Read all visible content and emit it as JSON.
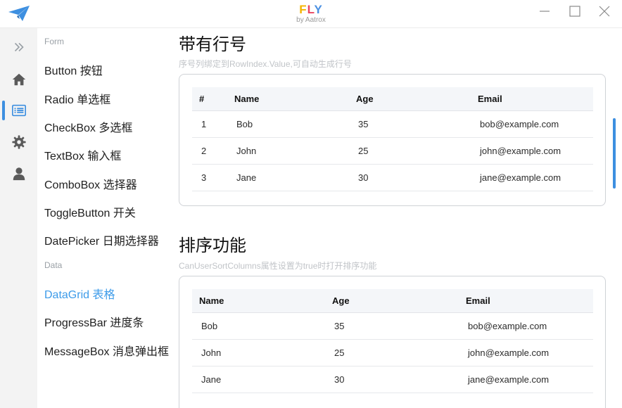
{
  "titlebar": {
    "brand_letters": [
      "F",
      "L",
      "Y"
    ],
    "brand_sub": "by Aatrox"
  },
  "rail": {
    "icons": [
      "chevron-double-right-icon",
      "home-icon",
      "list-icon",
      "gear-icon",
      "user-icon"
    ],
    "active_index": 2
  },
  "nav": {
    "groups": [
      {
        "label": "Form",
        "items": [
          "Button 按钮",
          "Radio 单选框",
          "CheckBox 多选框",
          "TextBox 输入框",
          "ComboBox 选择器",
          "ToggleButton 开关",
          "DatePicker 日期选择器"
        ]
      },
      {
        "label": "Data",
        "items": [
          "DataGrid 表格",
          "ProgressBar 进度条",
          "MessageBox 消息弹出框"
        ]
      }
    ],
    "active_item": "DataGrid 表格"
  },
  "sections": [
    {
      "title": "带有行号",
      "desc": "序号列绑定到RowIndex.Value,可自动生成行号",
      "columns": [
        "#",
        "Name",
        "Age",
        "Email"
      ],
      "rows": [
        [
          "1",
          "Bob",
          "35",
          "bob@example.com"
        ],
        [
          "2",
          "John",
          "25",
          "john@example.com"
        ],
        [
          "3",
          "Jane",
          "30",
          "jane@example.com"
        ]
      ]
    },
    {
      "title": "排序功能",
      "desc": "CanUserSortColumns属性设置为true时打开排序功能",
      "columns": [
        "Name",
        "Age",
        "Email"
      ],
      "rows": [
        [
          "Bob",
          "35",
          "bob@example.com"
        ],
        [
          "John",
          "25",
          "john@example.com"
        ],
        [
          "Jane",
          "30",
          "jane@example.com"
        ]
      ]
    }
  ],
  "colors": {
    "accent": "#3d8fe0",
    "brand_f": "#f4b400",
    "brand_l": "#e94560",
    "brand_y": "#4a90e2"
  }
}
